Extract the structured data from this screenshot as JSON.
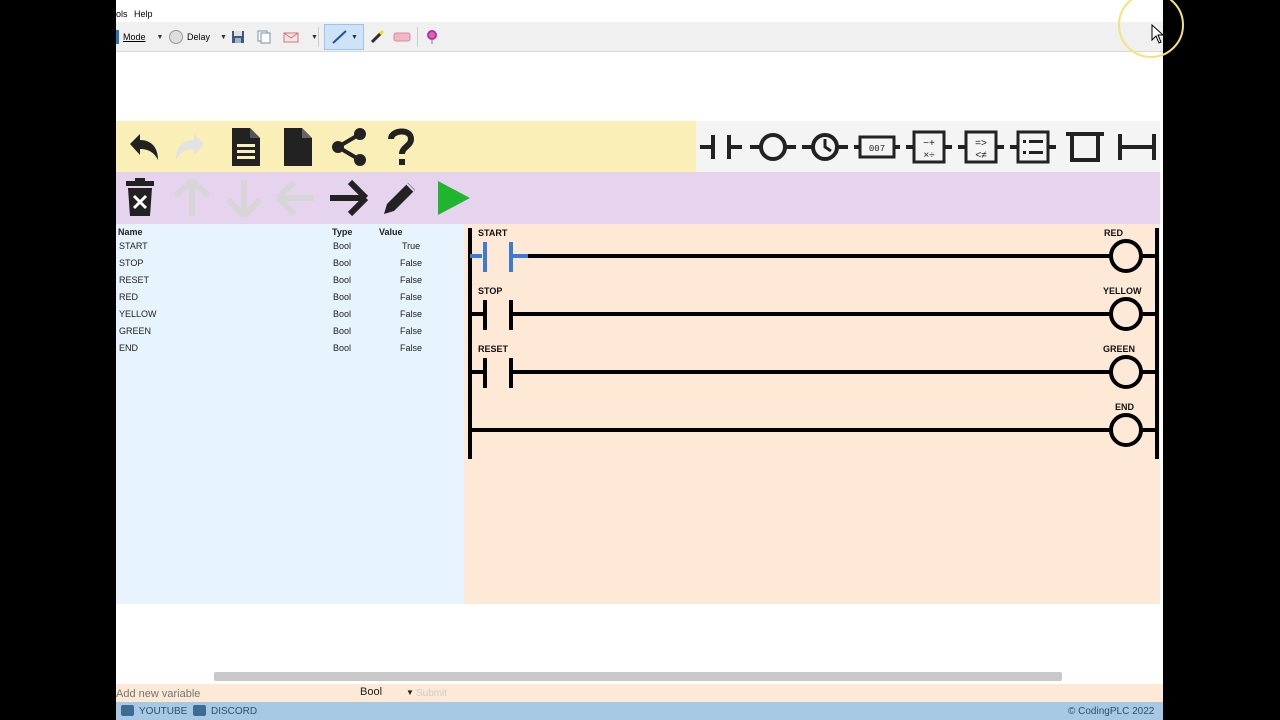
{
  "menubar": {
    "tools_label": "ols",
    "help_label": "Help"
  },
  "toolbar": {
    "mode_label": "Mode",
    "delay_label": "Delay"
  },
  "app_toolbar": {
    "row1_left": [
      "undo-icon",
      "redo-icon",
      "new-document-icon",
      "blank-document-icon",
      "share-icon",
      "help-icon"
    ],
    "row1_right": [
      "contact-icon",
      "coil-icon",
      "timer-icon",
      "counter-icon",
      "math-icon",
      "compare-icon",
      "list-icon",
      "branch-icon",
      "wire-icon"
    ],
    "row2": [
      "delete-icon",
      "up-arrow-icon",
      "down-arrow-icon",
      "left-arrow-icon",
      "right-arrow-icon",
      "edit-icon",
      "run-icon"
    ],
    "run_color": "#1fb52e"
  },
  "variables": {
    "headers": {
      "name": "Name",
      "type": "Type",
      "value": "Value"
    },
    "rows": [
      {
        "name": "START",
        "type": "Bool",
        "value": "True"
      },
      {
        "name": "STOP",
        "type": "Bool",
        "value": "False"
      },
      {
        "name": "RESET",
        "type": "Bool",
        "value": "False"
      },
      {
        "name": "RED",
        "type": "Bool",
        "value": "False"
      },
      {
        "name": "YELLOW",
        "type": "Bool",
        "value": "False"
      },
      {
        "name": "GREEN",
        "type": "Bool",
        "value": "False"
      },
      {
        "name": "END",
        "type": "Bool",
        "value": "False"
      }
    ]
  },
  "ladder": {
    "rungs": [
      {
        "contact": "START",
        "coil": "RED",
        "contact_active": true
      },
      {
        "contact": "STOP",
        "coil": "YELLOW",
        "contact_active": false
      },
      {
        "contact": "RESET",
        "coil": "GREEN",
        "contact_active": false
      },
      {
        "contact": "",
        "coil": "END",
        "contact_active": false
      }
    ],
    "active_color": "#3a7bd5"
  },
  "add_variable": {
    "placeholder": "Add new variable",
    "type_value": "Bool",
    "submit_label": "Submit"
  },
  "footer": {
    "youtube_label": "YOUTUBE",
    "discord_label": "DISCORD",
    "copyright": "© CodingPLC 2022"
  }
}
